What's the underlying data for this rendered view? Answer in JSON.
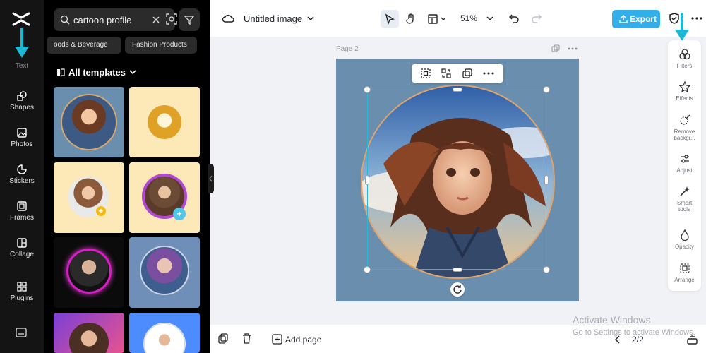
{
  "rail": {
    "items": [
      {
        "label": "Text"
      },
      {
        "label": "Shapes"
      },
      {
        "label": "Photos"
      },
      {
        "label": "Stickers"
      },
      {
        "label": "Frames"
      },
      {
        "label": "Collage"
      },
      {
        "label": "Plugins"
      }
    ]
  },
  "panel": {
    "search": {
      "value": "cartoon profile"
    },
    "chips": [
      "oods & Beverage",
      "Fashion Products"
    ],
    "section_title": "All templates"
  },
  "topbar": {
    "title": "Untitled image",
    "zoom": "51%",
    "export_label": "Export"
  },
  "canvas": {
    "page_label": "Page 2"
  },
  "side_tools": [
    {
      "label": "Filters"
    },
    {
      "label": "Effects"
    },
    {
      "label": "Remove backgr..."
    },
    {
      "label": "Adjust"
    },
    {
      "label": "Smart tools"
    },
    {
      "label": "Opacity"
    },
    {
      "label": "Arrange"
    }
  ],
  "bottombar": {
    "add_page": "Add page",
    "page_count": "2/2"
  },
  "watermark": {
    "line1": "Activate Windows",
    "line2": "Go to Settings to activate Windows."
  },
  "colors": {
    "accent": "#33aee9",
    "selection": "#29b7d8",
    "canvas_bg": "#6a8fae",
    "annotation_arrow": "#1ab8d4"
  }
}
